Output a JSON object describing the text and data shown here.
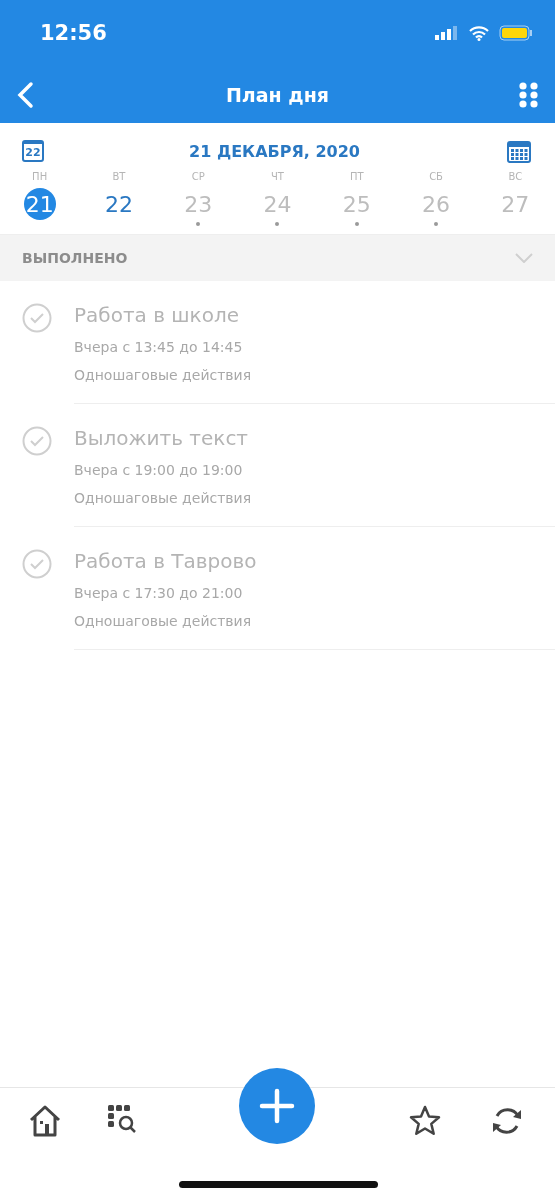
{
  "status_bar": {
    "time": "12:56"
  },
  "nav": {
    "title": "План дня"
  },
  "date_header": {
    "today_badge": "22",
    "date": "21 ДЕКАБРЯ, 2020"
  },
  "week": [
    {
      "weekday": "ПН",
      "day": "21",
      "selected": true,
      "highlighted": false,
      "has_tasks": false
    },
    {
      "weekday": "ВТ",
      "day": "22",
      "selected": false,
      "highlighted": true,
      "has_tasks": false
    },
    {
      "weekday": "СР",
      "day": "23",
      "selected": false,
      "highlighted": false,
      "has_tasks": true
    },
    {
      "weekday": "ЧТ",
      "day": "24",
      "selected": false,
      "highlighted": false,
      "has_tasks": true
    },
    {
      "weekday": "ПТ",
      "day": "25",
      "selected": false,
      "highlighted": false,
      "has_tasks": true
    },
    {
      "weekday": "СБ",
      "day": "26",
      "selected": false,
      "highlighted": false,
      "has_tasks": true
    },
    {
      "weekday": "ВС",
      "day": "27",
      "selected": false,
      "highlighted": false,
      "has_tasks": false
    }
  ],
  "section": {
    "title": "ВЫПОЛНЕНО",
    "expanded": false
  },
  "tasks": [
    {
      "title": "Работа в школе",
      "time": "Вчера с 13:45 до 14:45",
      "category": "Одношаговые действия",
      "done": true
    },
    {
      "title": "Выложить текст",
      "time": "Вчера с 19:00 до 19:00",
      "category": "Одношаговые действия",
      "done": true
    },
    {
      "title": "Работа в Таврово",
      "time": "Вчера с 17:30 до 21:00",
      "category": "Одношаговые действия",
      "done": true
    }
  ]
}
